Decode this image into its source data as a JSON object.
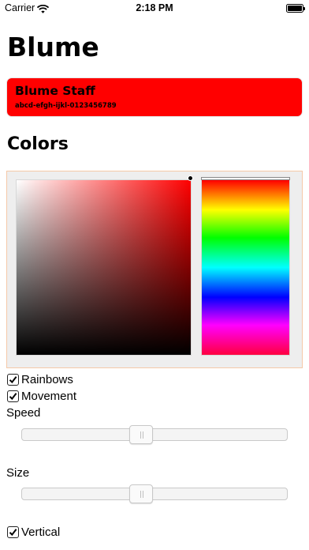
{
  "status_bar": {
    "carrier": "Carrier",
    "time": "2:18 PM",
    "wifi_icon": "wifi-icon",
    "battery_icon": "battery-icon"
  },
  "title": "Blume",
  "staff_card": {
    "name": "Blume Staff",
    "code": "abcd-efgh-ijkl-0123456789",
    "color": "#ff0000"
  },
  "colors_section": {
    "title": "Colors",
    "selected_hue": "#ff0000",
    "selected_color": "#ff0000"
  },
  "options": {
    "rainbows": {
      "label": "Rainbows",
      "checked": true
    },
    "movement": {
      "label": "Movement",
      "checked": true
    },
    "vertical": {
      "label": "Vertical",
      "checked": true
    }
  },
  "speed": {
    "label": "Speed",
    "value": 0.5
  },
  "size": {
    "label": "Size",
    "value": 0.5
  }
}
